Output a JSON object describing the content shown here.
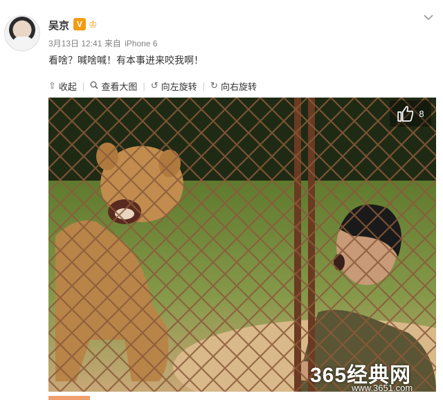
{
  "post": {
    "author": "吴京",
    "vip_badge": "V",
    "date": "3月13日 12:41",
    "source_prefix": "来自",
    "source_device": "iPhone 6",
    "text": "看啥？喊啥喊！有本事进来咬我啊！"
  },
  "toolbar": {
    "collapse": "收起",
    "view_large": "查看大图",
    "rotate_left": "向左旋转",
    "rotate_right": "向右旋转"
  },
  "photo": {
    "like_count": "8"
  },
  "watermark": {
    "brand": "365经典网",
    "url": "www.3651.com"
  },
  "icons": {
    "avatar": "avatar",
    "vip": "vip-icon",
    "member": "member-icon",
    "chevron": "chevron-down-icon",
    "collapse": "collapse-icon",
    "search": "magnifier-icon",
    "rotate_left": "rotate-left-icon",
    "rotate_right": "rotate-right-icon",
    "like": "thumbs-up-icon"
  },
  "colors": {
    "badge": "#f39c12",
    "meta": "#808080"
  }
}
